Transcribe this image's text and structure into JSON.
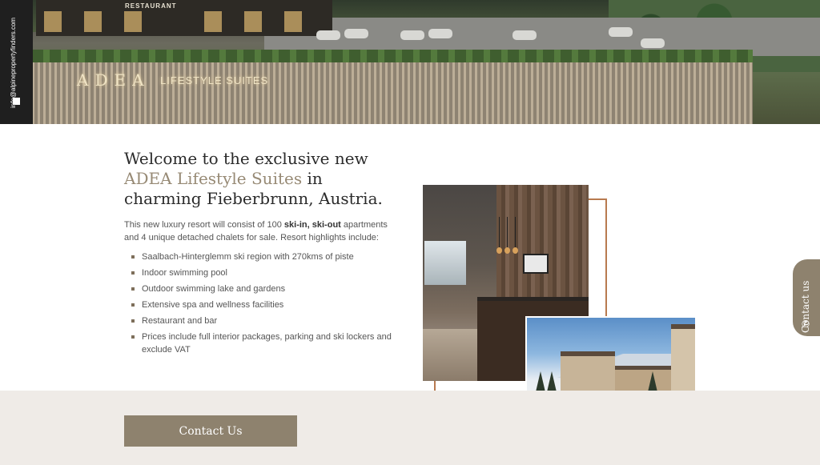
{
  "hero": {
    "restaurant_sign": "RESTAURANT",
    "brand_main": "ADEA",
    "brand_sub": "LIFESTYLE SUITES",
    "email": "info@alpinepropertyfinders.com"
  },
  "welcome": {
    "line_before": "Welcome to the exclusive new ",
    "accent": "ADEA Lifestyle Suites",
    "line_after": " in charming Fieberbrunn, Austria."
  },
  "intro": {
    "part1": "This new luxury resort will consist of 100 ",
    "bold": "ski-in, ski-out",
    "part2": " apartments and 4 unique detached chalets for sale. Resort highlights include:"
  },
  "highlights": [
    "Saalbach-Hinterglemm ski region with 270kms of piste",
    "Indoor swimming pool",
    "Outdoor swimming lake and gardens",
    "Extensive spa and wellness facilities",
    "Restaurant and bar",
    "Prices include full interior packages, parking and ski lockers and exclude VAT"
  ],
  "contact_tab": {
    "label": "Contact us",
    "icon": "phone-icon"
  },
  "cta": {
    "label": "Contact Us"
  },
  "colors": {
    "accent": "#978a75",
    "button": "#8e826e",
    "frame": "#b87a4f",
    "band": "#efebe7"
  }
}
